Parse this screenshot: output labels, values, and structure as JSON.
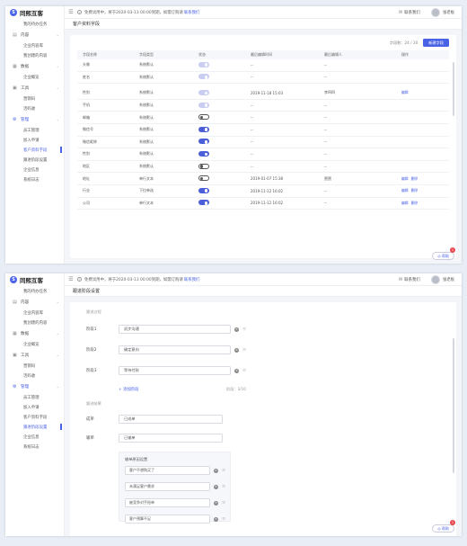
{
  "app": {
    "logo_text": "同熙互客",
    "logo_glyph": "S"
  },
  "topbar": {
    "notice_prefix": "免费试用中，将于2020-03-13 00:00到期，如需订购请",
    "notice_link": "联系我们",
    "contact": "联系我们",
    "user": "张老板"
  },
  "frame1": {
    "sidebar": [
      {
        "kind": "item",
        "label": "我的待办任务",
        "active": false
      },
      {
        "kind": "group",
        "icon": "▤",
        "label": "内容",
        "active": false
      },
      {
        "kind": "item",
        "label": "企业内容库",
        "active": false
      },
      {
        "kind": "item",
        "label": "我创建的内容",
        "active": false
      },
      {
        "kind": "group",
        "icon": "▦",
        "label": "数据",
        "active": false
      },
      {
        "kind": "item",
        "label": "企业概览",
        "active": false
      },
      {
        "kind": "group",
        "icon": "▣",
        "label": "工具",
        "active": false
      },
      {
        "kind": "item",
        "label": "营销码",
        "active": false
      },
      {
        "kind": "item",
        "label": "活码收",
        "active": false
      },
      {
        "kind": "group",
        "icon": "⚙",
        "label": "管理",
        "active": true
      },
      {
        "kind": "item",
        "label": "员工管理",
        "active": false
      },
      {
        "kind": "item",
        "label": "加入申请",
        "active": false
      },
      {
        "kind": "item",
        "label": "客户资料字段",
        "active": true
      },
      {
        "kind": "item",
        "label": "跟进阶段设置",
        "active": false
      },
      {
        "kind": "item",
        "label": "企业信息",
        "active": false
      },
      {
        "kind": "item",
        "label": "系统日志",
        "active": false
      }
    ],
    "page_title": "客户资料字段",
    "count": "字段数：24 / 30",
    "new_button": "新建字段",
    "columns": [
      "字段名称",
      "字段类型",
      "状态",
      "最后编辑时间",
      "最后编辑人",
      "操作"
    ],
    "rows": [
      {
        "name": "头像",
        "type": "系统默认",
        "toggle": "dis",
        "time": "--",
        "editor": "--",
        "ops": []
      },
      {
        "name": "姓名",
        "type": "系统默认",
        "toggle": "dis",
        "time": "--",
        "editor": "--",
        "ops": [],
        "gap_after": true
      },
      {
        "name": "性别",
        "type": "系统默认",
        "toggle": "dis",
        "time": "2019-11-18 15:03",
        "editor": "李四四",
        "ops": [
          "编辑"
        ]
      },
      {
        "name": "手机",
        "type": "系统默认",
        "toggle": "dis",
        "time": "--",
        "editor": "--",
        "ops": []
      },
      {
        "name": "邮箱",
        "type": "系统默认",
        "toggle": "off",
        "time": "--",
        "editor": "--",
        "ops": []
      },
      {
        "name": "微信号",
        "type": "系统默认",
        "toggle": "on",
        "time": "--",
        "editor": "--",
        "ops": []
      },
      {
        "name": "微信昵称",
        "type": "系统默认",
        "toggle": "on",
        "time": "--",
        "editor": "--",
        "ops": []
      },
      {
        "name": "性别",
        "type": "系统默认",
        "toggle": "on",
        "time": "--",
        "editor": "--",
        "ops": []
      },
      {
        "name": "地区",
        "type": "系统默认",
        "toggle": "off",
        "time": "--",
        "editor": "--",
        "ops": []
      },
      {
        "name": "地址",
        "type": "单行文本",
        "toggle": "off",
        "time": "2019-01-07 15:38",
        "editor": "贾贾",
        "ops": [
          "编辑",
          "删除"
        ]
      },
      {
        "name": "行业",
        "type": "下拉单选",
        "toggle": "on",
        "time": "2019-11-12 16:02",
        "editor": "--",
        "ops": [
          "编辑",
          "删除"
        ]
      },
      {
        "name": "公司",
        "type": "单行文本",
        "toggle": "on",
        "time": "2019-11-12 16:02",
        "editor": "--",
        "ops": [
          "编辑",
          "删除"
        ]
      }
    ],
    "help": "帮助",
    "badge": "1"
  },
  "frame2": {
    "sidebar": [
      {
        "kind": "item",
        "label": "我的待办任务",
        "active": false
      },
      {
        "kind": "group",
        "icon": "▤",
        "label": "内容",
        "active": false
      },
      {
        "kind": "item",
        "label": "企业内容库",
        "active": false
      },
      {
        "kind": "item",
        "label": "我创建的内容",
        "active": false
      },
      {
        "kind": "group",
        "icon": "▦",
        "label": "数据",
        "active": false
      },
      {
        "kind": "item",
        "label": "企业概览",
        "active": false
      },
      {
        "kind": "group",
        "icon": "▣",
        "label": "工具",
        "active": false
      },
      {
        "kind": "item",
        "label": "营销码",
        "active": false
      },
      {
        "kind": "item",
        "label": "活码收",
        "active": false
      },
      {
        "kind": "group",
        "icon": "⚙",
        "label": "管理",
        "active": true
      },
      {
        "kind": "item",
        "label": "员工管理",
        "active": false
      },
      {
        "kind": "item",
        "label": "加入申请",
        "active": false
      },
      {
        "kind": "item",
        "label": "客户资料字段",
        "active": false
      },
      {
        "kind": "item",
        "label": "跟进阶段设置",
        "active": true
      },
      {
        "kind": "item",
        "label": "企业信息",
        "active": false
      },
      {
        "kind": "item",
        "label": "系统日志",
        "active": false
      }
    ],
    "page_title": "跟进阶段设置",
    "sec1_title": "跟进过程",
    "stages": [
      {
        "label": "阶段1",
        "value": "初步沟通"
      },
      {
        "label": "阶段2",
        "value": "确定意向"
      },
      {
        "label": "阶段3",
        "value": "等待付款"
      }
    ],
    "add_stage": "+ 添加阶段",
    "stage_count": "阶段：3/10",
    "sec2_title": "跟进结果",
    "results": [
      {
        "label": "成单",
        "value": "已成单"
      },
      {
        "label": "输单",
        "value": "已输单"
      }
    ],
    "reason_title": "输单原因设置",
    "reasons": [
      "客户不想购买了",
      "未满足客户需求",
      "被竞争对手抢单",
      "客户预算不足"
    ],
    "help": "帮助",
    "badge": "1"
  },
  "colors": {
    "accent": "#4a63e6",
    "badge": "#e5484d"
  }
}
